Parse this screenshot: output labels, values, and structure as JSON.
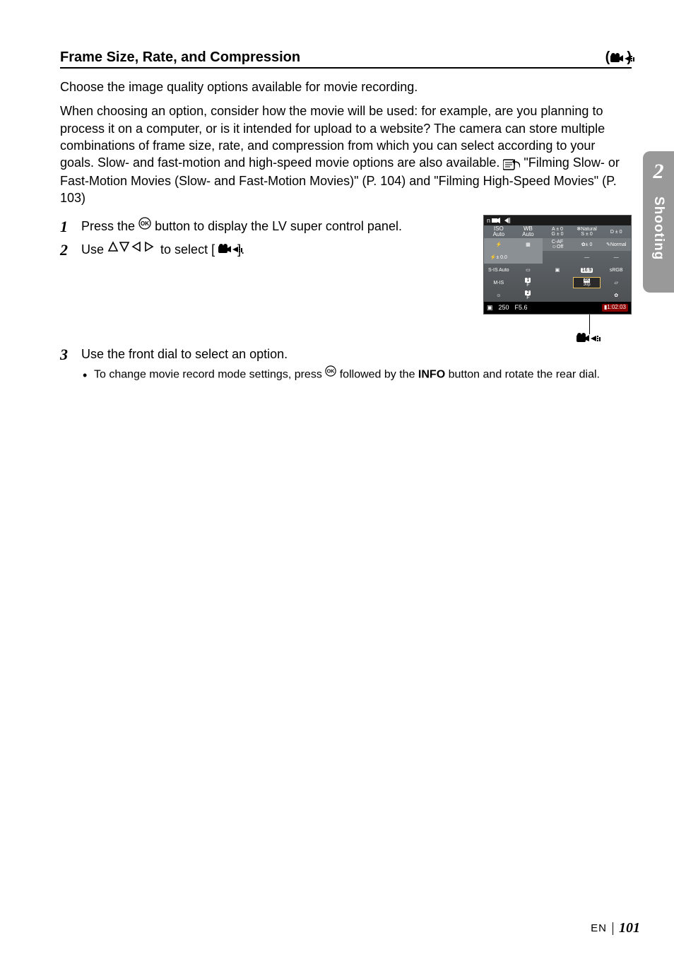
{
  "side_tab": {
    "number": "2",
    "label": "Shooting"
  },
  "heading": {
    "title": "Frame Size, Rate, and Compression",
    "right_open": "(",
    "right_close": ")"
  },
  "intro": "Choose the image quality options available for movie recording.",
  "para": "When choosing an option, consider how the movie will be used: for example, are you planning to process it on a computer, or is it intended for upload to a website? The camera can store multiple combinations of frame size, rate, and compression from which you can select according to your goals. Slow- and fast-motion and high-speed movie options are also available.",
  "xref": " \"Filming Slow- or Fast-Motion Movies (Slow- and Fast-Motion Movies)\" (P. 104) and \"Filming High-Speed Movies\" (P. 103)",
  "steps": {
    "s1_num": "1",
    "s1_a": "Press the ",
    "s1_b": " button to display the LV super control panel.",
    "s2_num": "2",
    "s2_a": "Use ",
    "s2_b": " to select [",
    "s2_c": "].",
    "s3_num": "3",
    "s3_text": "Use the front dial to select an option.",
    "s3_bullet_a": "To change movie record mode settings, press ",
    "s3_bullet_b": " followed by the ",
    "s3_bullet_info": "INFO",
    "s3_bullet_c": " button and rotate the rear dial."
  },
  "panel": {
    "top_label": "n",
    "row1": {
      "c1a": "ISO",
      "c1b": "Auto",
      "c2a": "WB",
      "c2b": "Auto",
      "c3a": "A ± 0",
      "c3b": "G ± 0",
      "c4": "Natural",
      "c5a": "S ± 0",
      "c5b": "D ± 0"
    },
    "row2": {
      "c1": "",
      "c2": "",
      "c3a": "C-AF",
      "c3b": "Off",
      "c4": "± 0",
      "c5": "Normal"
    },
    "row3": {
      "c1": "± 0.0",
      "c4": "—",
      "c5": "—"
    },
    "row4": {
      "c1": "S-IS Auto",
      "c4": "16:9",
      "c5": "sRGB"
    },
    "row5": {
      "c1": "M-IS",
      "c2": "1",
      "c3": "F",
      "c4": "4K",
      "c4b": "30p",
      "c5": ""
    },
    "row6": {
      "c2": "2",
      "c3": "F"
    },
    "bottom": {
      "shutter": "250",
      "fnum": "F5.6",
      "time": "1:02:03"
    }
  },
  "footer": {
    "lang": "EN",
    "page": "101"
  }
}
